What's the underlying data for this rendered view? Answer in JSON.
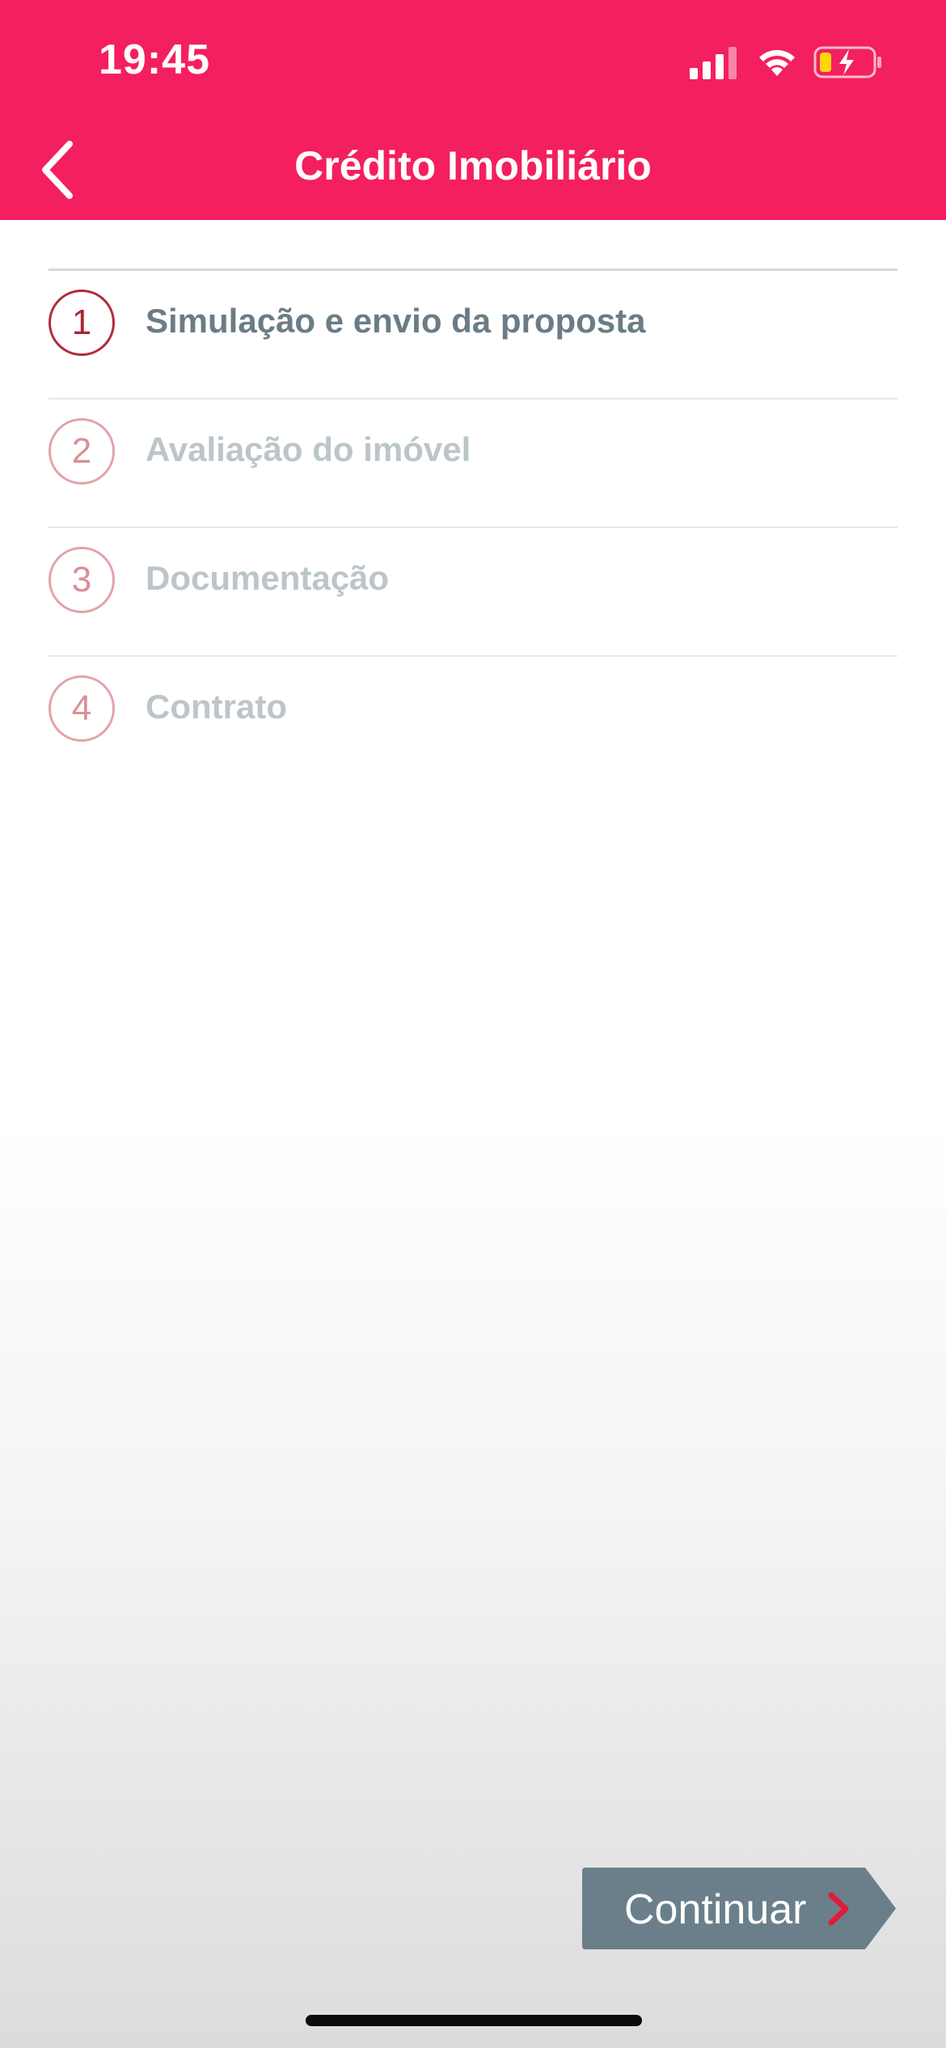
{
  "status_bar": {
    "time": "19:45"
  },
  "nav": {
    "title": "Crédito Imobiliário",
    "back_icon": "chevron-left-icon"
  },
  "steps": [
    {
      "number": "1",
      "label": "Simulação e envio da proposta",
      "active": true
    },
    {
      "number": "2",
      "label": "Avaliação do imóvel",
      "active": false
    },
    {
      "number": "3",
      "label": "Documentação",
      "active": false
    },
    {
      "number": "4",
      "label": "Contrato",
      "active": false
    }
  ],
  "actions": {
    "continue_label": "Continuar",
    "continue_icon": "chevron-right-icon"
  },
  "colors": {
    "header_bg": "#f41f5e",
    "button_bg": "#6b7f8b",
    "active_step": "#a92535",
    "inactive_step": "#d98f98",
    "chevron_accent": "#e21a3c"
  }
}
